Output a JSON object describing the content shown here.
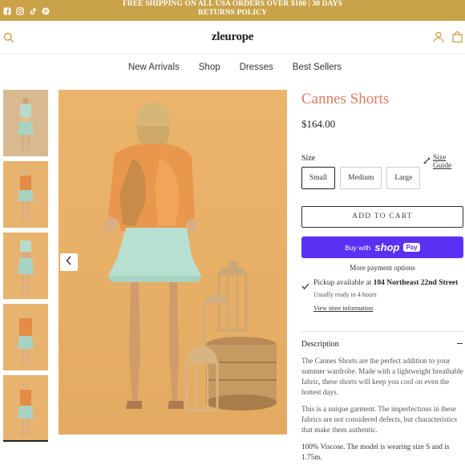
{
  "announcement": {
    "text": "FREE SHIPPING ON ALL USA ORDERS OVER $100 | 30 DAYS RETURNS POLICY",
    "social_icons": [
      "facebook-icon",
      "instagram-icon",
      "tiktok-icon",
      "pinterest-icon"
    ]
  },
  "header": {
    "logo": "zleurope"
  },
  "nav": {
    "items": [
      "New Arrivals",
      "Shop",
      "Dresses",
      "Best Sellers"
    ]
  },
  "product": {
    "title": "Cannes Shorts",
    "price": "$164.00",
    "size_label": "Size",
    "size_guide": "Size Guide",
    "sizes": [
      "Small",
      "Medium",
      "Large"
    ],
    "selected_size": "Small",
    "add_to_cart": "ADD TO CART",
    "buy_with": "Buy with",
    "shop_brand": "shop",
    "shop_pay": "Pay",
    "more_payment": "More payment options"
  },
  "pickup": {
    "prefix": "Pickup available at ",
    "location": "104 Northeast 22nd Street",
    "ready": "Usually ready in 4 hours",
    "store_link": "View store information"
  },
  "description": {
    "heading": "Description",
    "p1": "The Cannes Shorts are the perfect addition to your summer wardrobe. Made with a lightweight breathable fabric, these shorts will keep you cool on even the hottest days.",
    "p2": "This is a unique garment. The imperfections in these fabrics are not considered defects, but characteristics that make them authentic.",
    "p3": "100% Viscose. The model is wearing size S and is 1.75m."
  },
  "colors": {
    "announcement_bg": "#c9a24a",
    "title": "#e07a5f",
    "shop_pay": "#5a31f4"
  }
}
